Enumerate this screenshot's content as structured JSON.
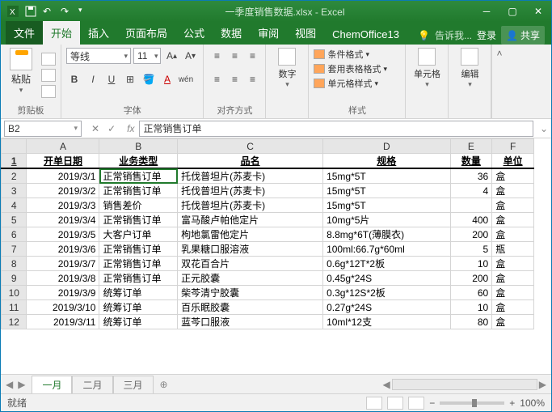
{
  "titlebar": {
    "title": "一季度销售数据.xlsx - Excel"
  },
  "tabs": {
    "file": "文件",
    "home": "开始",
    "insert": "插入",
    "layout": "页面布局",
    "formulas": "公式",
    "data": "数据",
    "review": "审阅",
    "view": "视图",
    "chem": "ChemOffice13",
    "tell": "告诉我...",
    "signin": "登录",
    "share": "共享"
  },
  "ribbon": {
    "clipboard": {
      "paste": "粘贴",
      "label": "剪贴板"
    },
    "font": {
      "name": "等线",
      "size": "11",
      "label": "字体"
    },
    "align": {
      "label": "对齐方式"
    },
    "number": {
      "btn": "数字",
      "label": "数字"
    },
    "styles": {
      "cond": "条件格式",
      "tbl": "套用表格格式",
      "cell": "单元格样式",
      "label": "样式"
    },
    "cells": {
      "btn": "单元格",
      "label": ""
    },
    "editing": {
      "btn": "编辑",
      "label": ""
    }
  },
  "namebox": "B2",
  "formula": "正常销售订单",
  "columns": [
    "A",
    "B",
    "C",
    "D",
    "E",
    "F"
  ],
  "headers": {
    "A": "开单日期",
    "B": "业务类型",
    "C": "品名",
    "D": "规格",
    "E": "数量",
    "F": "单位"
  },
  "rows": [
    {
      "n": 2,
      "A": "2019/3/1",
      "B": "正常销售订单",
      "C": "托伐普坦片(苏麦卡)",
      "D": "15mg*5T",
      "E": "36",
      "F": "盒"
    },
    {
      "n": 3,
      "A": "2019/3/2",
      "B": "正常销售订单",
      "C": "托伐普坦片(苏麦卡)",
      "D": "15mg*5T",
      "E": "4",
      "F": "盒"
    },
    {
      "n": 4,
      "A": "2019/3/3",
      "B": "销售差价",
      "C": "托伐普坦片(苏麦卡)",
      "D": "15mg*5T",
      "E": "",
      "F": "盒"
    },
    {
      "n": 5,
      "A": "2019/3/4",
      "B": "正常销售订单",
      "C": "富马酸卢帕他定片",
      "D": "10mg*5片",
      "E": "400",
      "F": "盒"
    },
    {
      "n": 6,
      "A": "2019/3/5",
      "B": "大客户订单",
      "C": "枸地氯雷他定片",
      "D": "8.8mg*6T(薄膜衣)",
      "E": "200",
      "F": "盒"
    },
    {
      "n": 7,
      "A": "2019/3/6",
      "B": "正常销售订单",
      "C": "乳果糖口服溶液",
      "D": "100ml:66.7g*60ml",
      "E": "5",
      "F": "瓶"
    },
    {
      "n": 8,
      "A": "2019/3/7",
      "B": "正常销售订单",
      "C": "双花百合片",
      "D": "0.6g*12T*2板",
      "E": "10",
      "F": "盒"
    },
    {
      "n": 9,
      "A": "2019/3/8",
      "B": "正常销售订单",
      "C": "正元胶囊",
      "D": "0.45g*24S",
      "E": "200",
      "F": "盒"
    },
    {
      "n": 10,
      "A": "2019/3/9",
      "B": "统筹订单",
      "C": "柴芩清宁胶囊",
      "D": "0.3g*12S*2板",
      "E": "60",
      "F": "盒"
    },
    {
      "n": 11,
      "A": "2019/3/10",
      "B": "统筹订单",
      "C": "百乐眠胶囊",
      "D": "0.27g*24S",
      "E": "10",
      "F": "盒"
    },
    {
      "n": 12,
      "A": "2019/3/11",
      "B": "统筹订单",
      "C": "蓝芩口服液",
      "D": "10ml*12支",
      "E": "80",
      "F": "盒"
    }
  ],
  "sheets": {
    "s1": "一月",
    "s2": "二月",
    "s3": "三月"
  },
  "status": {
    "ready": "就绪",
    "zoom": "100%"
  }
}
